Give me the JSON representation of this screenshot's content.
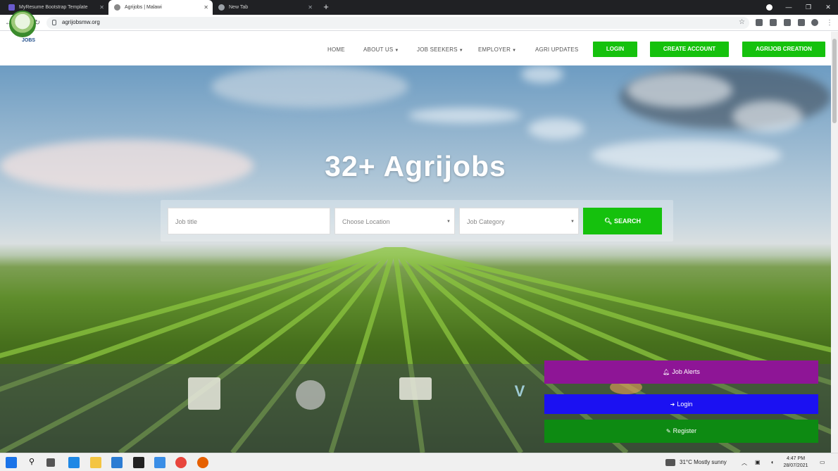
{
  "browser": {
    "tabs": [
      {
        "title": "MyResume Bootstrap Template",
        "active": false
      },
      {
        "title": "Agrijobs | Malawi",
        "active": true
      },
      {
        "title": "New Tab",
        "active": false
      }
    ],
    "url": "agrijobsmw.org"
  },
  "site": {
    "logo_text": "JOBS",
    "nav": {
      "home": "HOME",
      "about": "ABOUT US",
      "seekers": "JOB SEEKERS",
      "employer": "EMPLOYER",
      "updates": "AGRI UPDATES"
    },
    "buttons": {
      "login": "LOGIN",
      "create_account": "CREATE ACCOUNT",
      "agrijob_creation": "AGRIJOB CREATION"
    }
  },
  "hero": {
    "title": "32+ Agrijobs",
    "search": {
      "job_title_placeholder": "Job title",
      "location_placeholder": "Choose Location",
      "category_placeholder": "Job Category",
      "button": "SEARCH"
    }
  },
  "cta": {
    "job_alerts": "Job Alerts",
    "login": "Login",
    "register": "Register"
  },
  "taskbar": {
    "weather": "31°C  Mostly sunny",
    "time": "4:47 PM",
    "date": "28/07/2021"
  },
  "colors": {
    "brand_green": "#15c10d",
    "job_alerts_purple": "#8e1596",
    "login_blue": "#1b11f2",
    "register_green": "#0d8a12"
  }
}
